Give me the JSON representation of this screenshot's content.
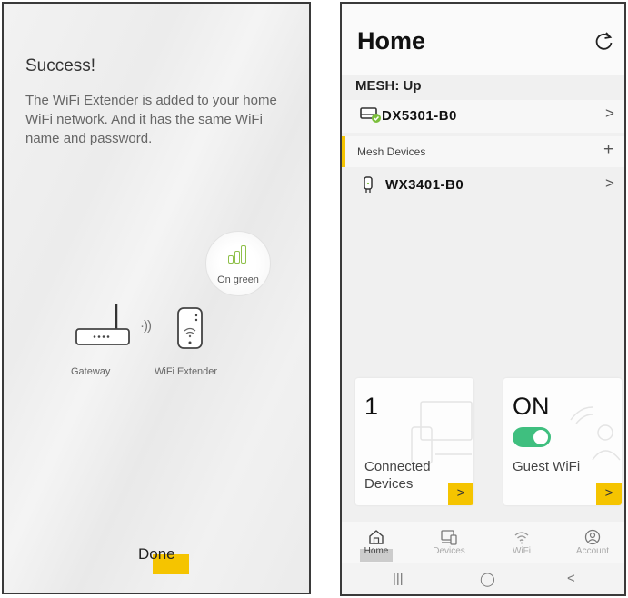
{
  "left_screen": {
    "title": "Success!",
    "body": "The WiFi Extender is added to your home WiFi network. And it has the same WiFi name and password.",
    "indicator_label": "On green",
    "gateway_label": "Gateway",
    "extender_label": "WiFi Extender",
    "signal_glyph": "·))",
    "done_label": "Done",
    "colors": {
      "accent": "#f5c400",
      "green": "#8fc04a"
    }
  },
  "right_screen": {
    "title": "Home",
    "refresh_icon": "refresh-icon",
    "mesh_status": "MESH: Up",
    "gateway_device": {
      "name": "DX5301-B0",
      "icon": "router-check-icon"
    },
    "mesh_section_label": "Mesh Devices",
    "add_glyph": "+",
    "chevron_glyph": ">",
    "mesh_device": {
      "name": "WX3401-B0",
      "icon": "extender-icon"
    },
    "cards": [
      {
        "value": "1",
        "label": "Connected Devices",
        "chevron": ">"
      },
      {
        "value": "ON",
        "label": "Guest WiFi",
        "chevron": ">",
        "toggle_on": true
      }
    ],
    "tabs": [
      {
        "label": "Home",
        "icon": "home-icon",
        "active": true
      },
      {
        "label": "Devices",
        "icon": "devices-icon",
        "active": false
      },
      {
        "label": "WiFi",
        "icon": "wifi-icon",
        "active": false
      },
      {
        "label": "Account",
        "icon": "account-icon",
        "active": false
      }
    ],
    "system_nav": {
      "recents": "|||",
      "home": "◯",
      "back": "<"
    },
    "colors": {
      "accent": "#f5c400",
      "toggle": "#3fbf7f",
      "check": "#7cbf3c"
    }
  }
}
